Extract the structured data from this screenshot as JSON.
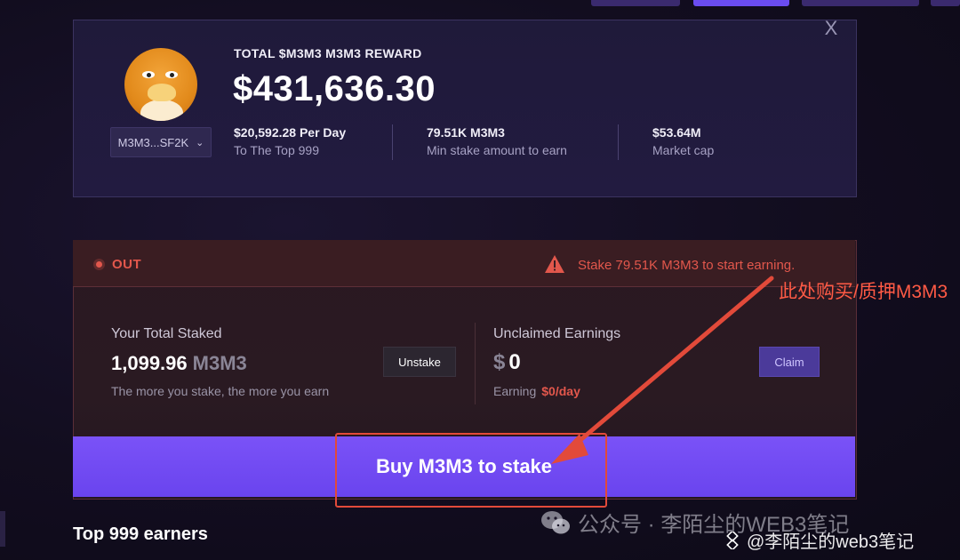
{
  "reward_card": {
    "title": "TOTAL $M3M3 M3M3 REWARD",
    "amount": "$431,636.30",
    "token_selector": "M3M3...SF2K",
    "stats": [
      {
        "value": "$20,592.28 Per Day",
        "label": "To The Top 999"
      },
      {
        "value": "79.51K M3M3",
        "label": "Min stake amount to earn"
      },
      {
        "value": "$53.64M",
        "label": "Market cap"
      }
    ],
    "close_label": "X"
  },
  "stake_card": {
    "status": "OUT",
    "warning": "Stake 79.51K M3M3 to start earning.",
    "total_staked_label": "Your Total Staked",
    "total_staked_value": "1,099.96",
    "total_staked_unit": "M3M3",
    "total_staked_hint": "The more you stake, the more you earn",
    "unstake_label": "Unstake",
    "unclaimed_label": "Unclaimed Earnings",
    "unclaimed_currency": "$",
    "unclaimed_value": "0",
    "earning_label": "Earning",
    "earning_rate": "$0/day",
    "claim_label": "Claim",
    "buy_label": "Buy M3M3 to stake"
  },
  "annotation": {
    "text": "此处购买/质押M3M3"
  },
  "earners_title": "Top 999 earners",
  "watermarks": {
    "wechat": "公众号 · 李陌尘的WEB3笔记",
    "binance": "@李陌尘的web3笔记"
  },
  "colors": {
    "accent": "#6a44ee",
    "danger": "#e2574c",
    "card_bg": "#221b40"
  }
}
